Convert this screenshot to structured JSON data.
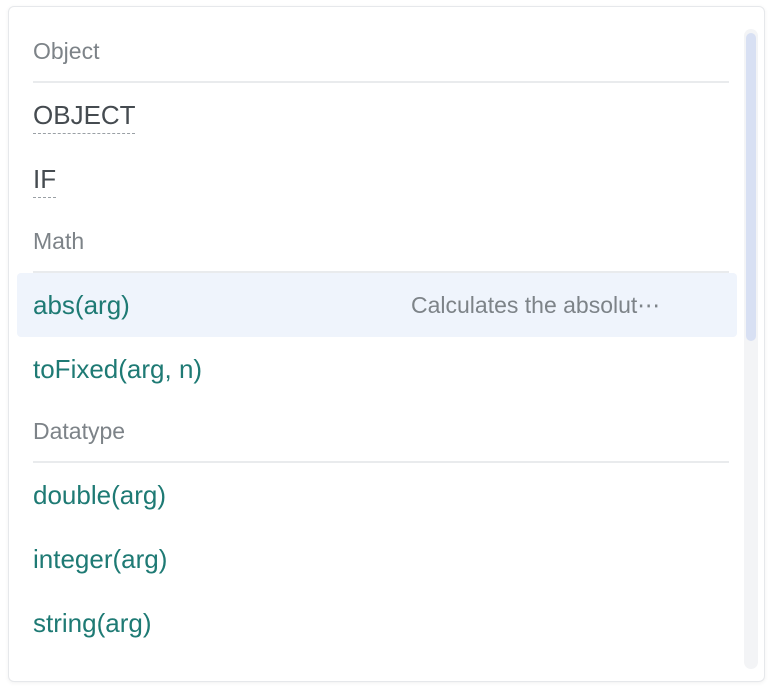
{
  "groups": {
    "object": {
      "label": "Object",
      "items": [
        "OBJECT",
        "IF"
      ]
    },
    "math": {
      "label": "Math",
      "items": [
        {
          "name": "abs(arg)",
          "desc": "Calculates the absolut⋯"
        },
        {
          "name": "toFixed(arg, n)"
        }
      ]
    },
    "datatype": {
      "label": "Datatype",
      "items": [
        "double(arg)",
        "integer(arg)",
        "string(arg)"
      ]
    }
  },
  "colors": {
    "function_text": "#1e7a74",
    "highlight_bg": "#eff4fc",
    "header_text": "#7d8388"
  }
}
